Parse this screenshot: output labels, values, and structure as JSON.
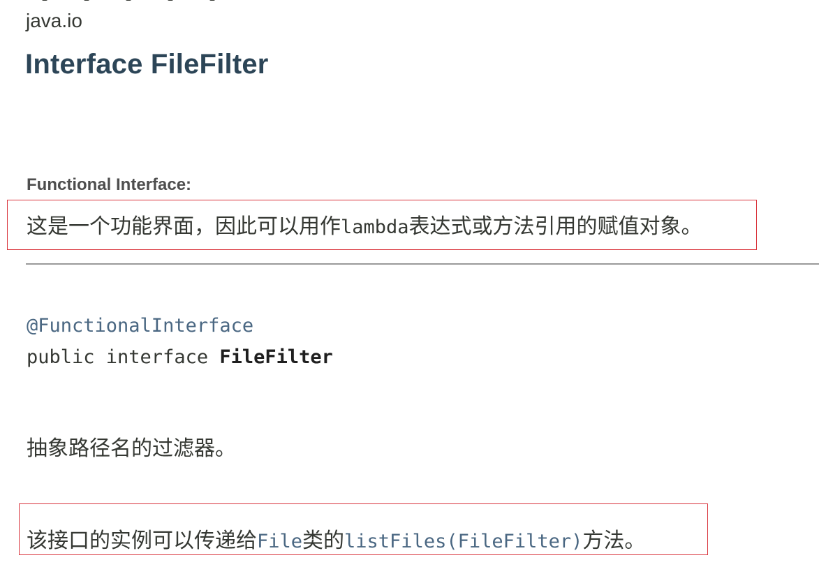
{
  "header": {
    "package": "java.io",
    "title": "Interface FileFilter"
  },
  "functional_interface": {
    "label": "Functional Interface:",
    "desc_prefix": "这是一个功能界面，因此可以用作",
    "desc_code": "lambda",
    "desc_suffix": "表达式或方法引用的赋值对象。"
  },
  "signature": {
    "annotation": "@FunctionalInterface",
    "declaration": "public interface ",
    "name": "FileFilter"
  },
  "description": {
    "line1": "抽象路径名的过滤器。",
    "line2_prefix": "该接口的实例可以传递给",
    "line2_link1": "File",
    "line2_mid": "类的",
    "line2_link2": "listFiles(FileFilter)",
    "line2_suffix": "方法。"
  },
  "colors": {
    "title": "#2c4557",
    "link": "#4a6782",
    "text": "#353833",
    "highlight_box": "#d9343c",
    "divider": "#9a9a9a"
  }
}
